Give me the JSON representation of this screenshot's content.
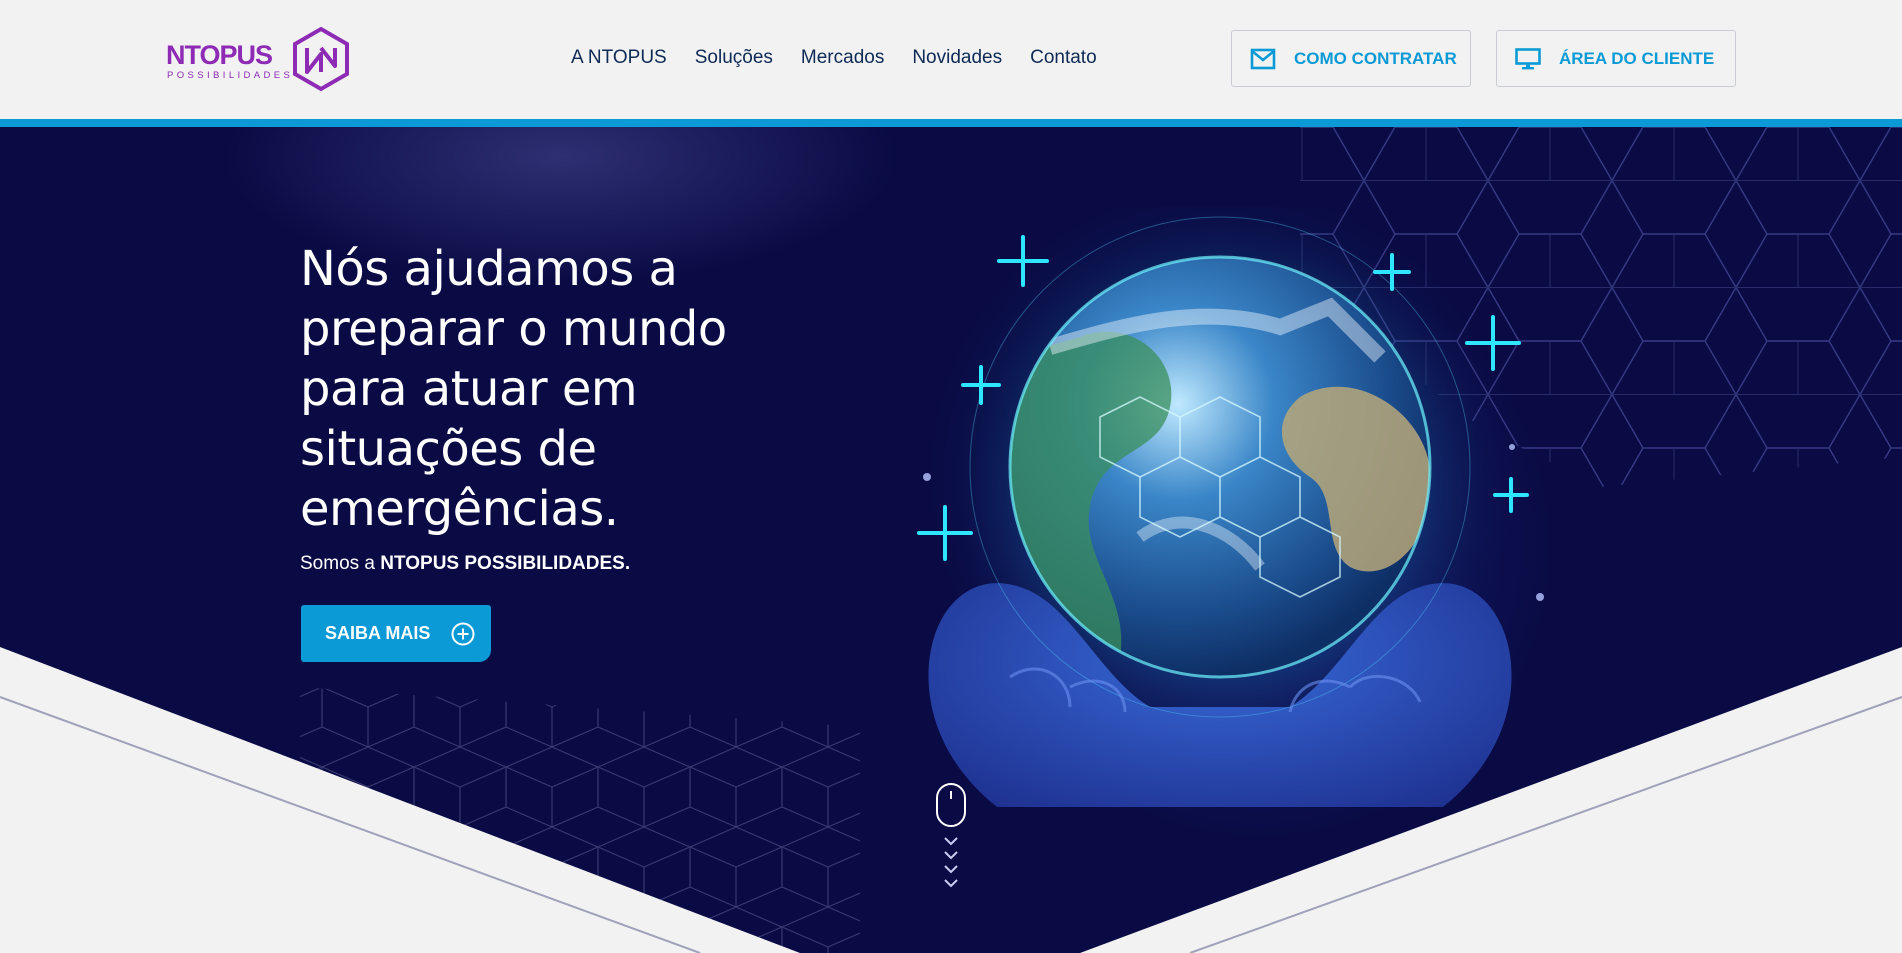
{
  "header": {
    "logo": {
      "name": "NTOPUS",
      "tagline": "POSSIBILIDADES"
    },
    "nav": [
      "A NTOPUS",
      "Soluções",
      "Mercados",
      "Novidades",
      "Contato"
    ],
    "buttons": {
      "contratar": "COMO CONTRATAR",
      "cliente": "ÁREA DO CLIENTE"
    }
  },
  "hero": {
    "headline_lines": [
      "Nós ajudamos a",
      "preparar o mundo",
      "para atuar em",
      "situações de",
      "emergências."
    ],
    "sub_prefix": "Somos a ",
    "sub_bold": "NTOPUS POSSIBILIDADES.",
    "cta": "SAIBA MAIS"
  },
  "icons": [
    "envelope-icon",
    "monitor-icon",
    "plus-circle-icon",
    "mouse-icon",
    "chevron-down-icon"
  ],
  "colors": {
    "brand_purple": "#8e2bb5",
    "accent_blue": "#0b9ad5",
    "hero_navy": "#0a0b45",
    "nav_text": "#0e2a55"
  }
}
